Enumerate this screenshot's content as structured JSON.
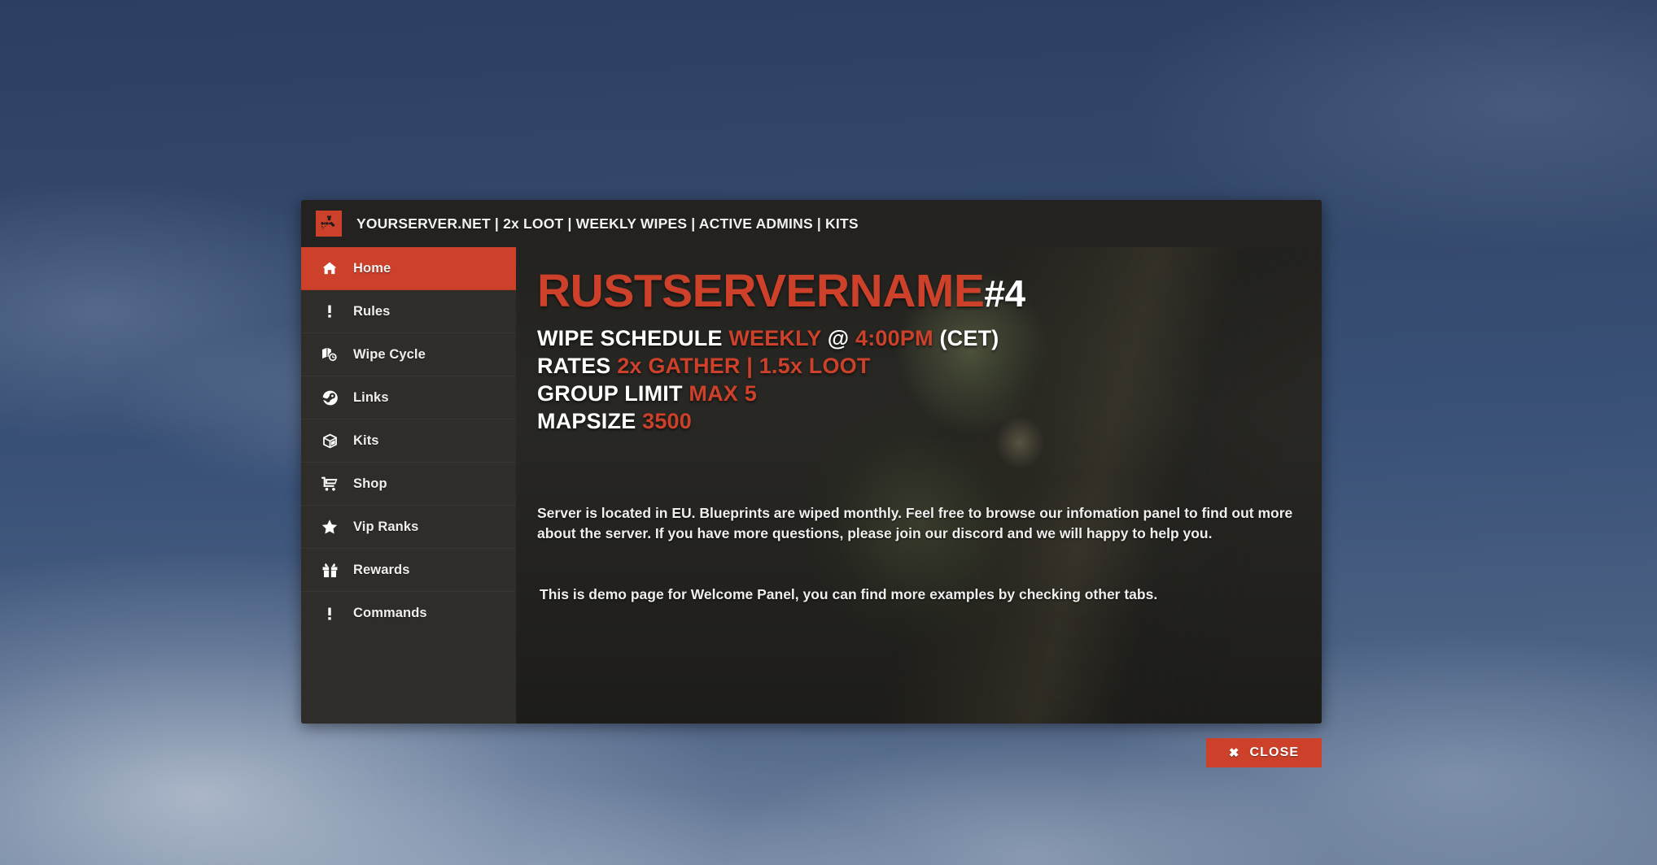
{
  "header": {
    "logo_icon": "rust-logo-icon",
    "title": "YOURSERVER.NET | 2x LOOT | WEEKLY WIPES | ACTIVE ADMINS | KITS"
  },
  "accent_color": "#cd412b",
  "panel_bg_color": "#2e2d29",
  "header_bg_color": "#232220",
  "sidebar": {
    "items": [
      {
        "label": "Home",
        "icon": "home-icon",
        "active": true
      },
      {
        "label": "Rules",
        "icon": "exclamation-icon",
        "active": false
      },
      {
        "label": "Wipe Cycle",
        "icon": "map-clock-icon",
        "active": false
      },
      {
        "label": "Links",
        "icon": "steam-icon",
        "active": false
      },
      {
        "label": "Kits",
        "icon": "box-icon",
        "active": false
      },
      {
        "label": "Shop",
        "icon": "shopping-cart-icon",
        "active": false
      },
      {
        "label": "Vip Ranks",
        "icon": "star-icon",
        "active": false
      },
      {
        "label": "Rewards",
        "icon": "gift-icon",
        "active": false
      },
      {
        "label": "Commands",
        "icon": "exclamation-icon",
        "active": false
      }
    ]
  },
  "main": {
    "server_name": "RUSTSERVERNAME",
    "server_number": "#4",
    "stats": [
      {
        "label": "WIPE SCHEDULE ",
        "value": "WEEKLY",
        "mid": " @ ",
        "value2": "4:00PM",
        "suffix": " (CET)"
      },
      {
        "label": "RATES ",
        "value": "2x GATHER | 1.5x LOOT",
        "mid": "",
        "value2": "",
        "suffix": ""
      },
      {
        "label": "GROUP LIMIT ",
        "value": "MAX 5",
        "mid": "",
        "value2": "",
        "suffix": ""
      },
      {
        "label": "MAPSIZE ",
        "value": "3500",
        "mid": "",
        "value2": "",
        "suffix": ""
      }
    ],
    "paragraph": "Server is located in EU. Blueprints are wiped monthly. Feel free to browse our infomation panel to find out more about the server. If you have more questions, please join our discord and we will happy to help you.",
    "demo_note": "This is demo page for Welcome Panel, you can find more examples by checking other tabs."
  },
  "footer": {
    "close_label": "CLOSE",
    "close_icon": "close-x-icon"
  }
}
